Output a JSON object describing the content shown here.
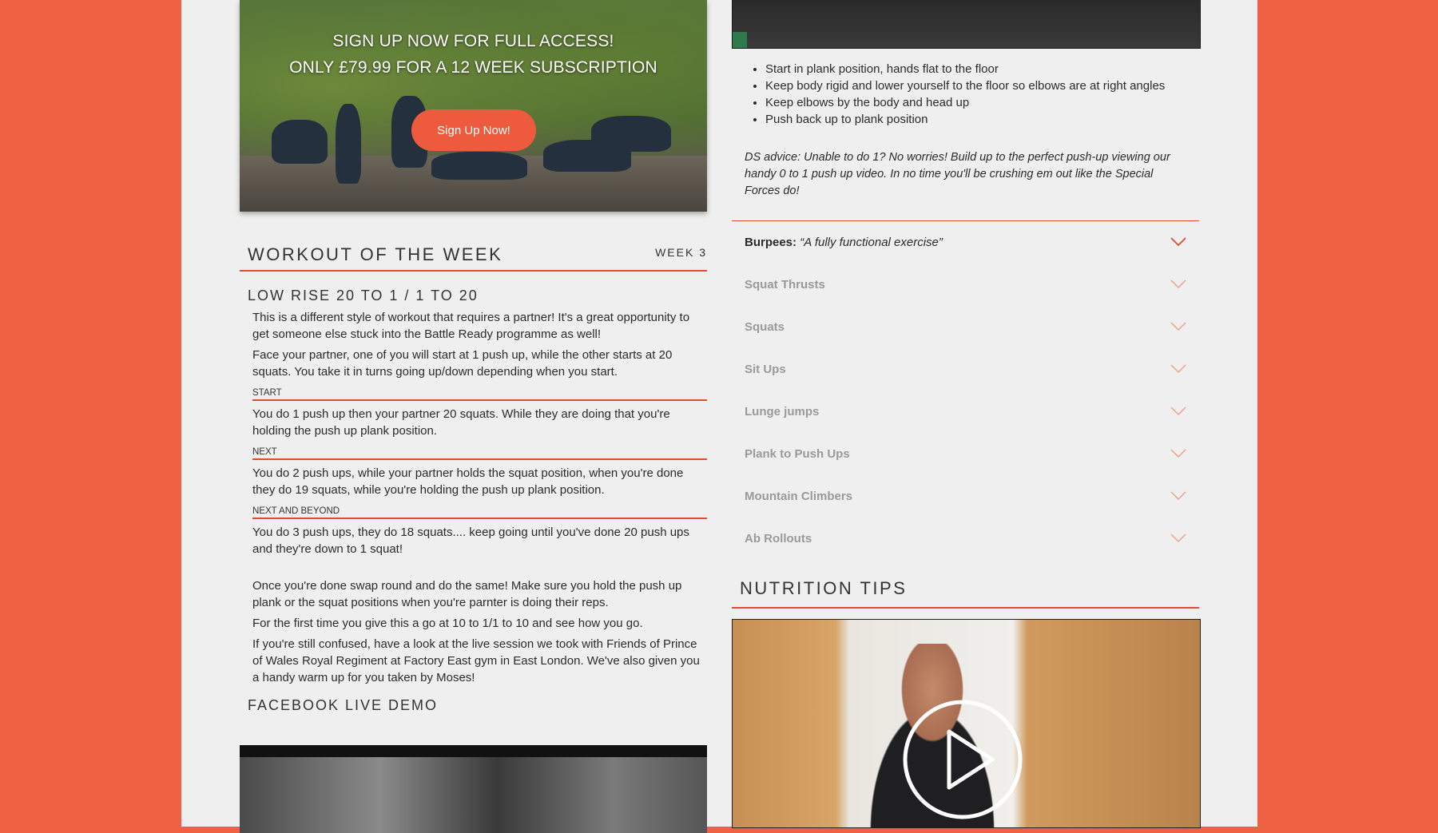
{
  "promo": {
    "line1": "SIGN UP NOW FOR FULL ACCESS!",
    "line2": "ONLY £79.99 FOR A 12 WEEK SUBSCRIPTION",
    "button": "Sign Up Now!"
  },
  "workout": {
    "section_title": "WORKOUT OF THE WEEK",
    "week": "WEEK 3",
    "title": "LOW RISE 20 TO 1 / 1 TO 20",
    "intro1": "This is a different style of workout that requires a partner! It's a great opportunity to get someone else stuck into the Battle Ready programme as well!",
    "intro2": "Face your partner, one of you will start at 1 push up, while the other starts at 20 squats. You take it in turns going up/down depending when you start.",
    "steps": [
      {
        "label": "START",
        "text": "You do 1 push up then your partner 20 squats. While they are doing that you're holding the push up plank position."
      },
      {
        "label": "NEXT",
        "text": "You do 2 push ups, while your partner holds the squat position, when you're done they do 19 squats, while you're holding the push up plank position."
      },
      {
        "label": "NEXT AND BEYOND",
        "text": "You do 3 push ups, they do 18 squats.... keep going until you've done 20 push ups and they're down to 1 squat!"
      }
    ],
    "outro1": "Once you're done swap round and do the same! Make sure you hold the push up plank or the squat positions when you're parnter is doing their reps.",
    "outro2": "For the first time you give this a go at 10 to 1/1 to 10 and see how you go.",
    "outro3": "If you're still confused, have a look at the live session we took with Friends of Prince of Wales Royal Regiment at Factory East gym in East London. We've also given you a handy warm up for you taken by Moses!",
    "demo_title": "FACEBOOK LIVE DEMO"
  },
  "exercise": {
    "bullets": [
      "Start in plank position, hands flat to the floor",
      "Keep body rigid and lower yourself to the floor so elbows are at right angles",
      "Keep elbows by the body and head up",
      "Push back up to plank position"
    ],
    "advice": "DS advice: Unable to do 1? No worries! Build up to the perfect push-up viewing our handy 0 to 1 push up video. In no time you'll be crushing em out like the Special Forces do!"
  },
  "accordion": [
    {
      "label": "Burpees:",
      "quote": "“A fully functional exercise”",
      "open": true
    },
    {
      "label": "Squat Thrusts"
    },
    {
      "label": "Squats"
    },
    {
      "label": "Sit Ups"
    },
    {
      "label": "Lunge jumps"
    },
    {
      "label": "Plank to Push Ups"
    },
    {
      "label": "Mountain Climbers"
    },
    {
      "label": "Ab Rollouts"
    }
  ],
  "nutrition": {
    "title": "NUTRITION TIPS"
  },
  "colors": {
    "accent": "#ee5a3d",
    "background": "#ee6142",
    "panel": "#efefef",
    "muted_text": "#9a9a9a"
  },
  "icons": [
    "chevron-down-icon",
    "play-icon"
  ]
}
